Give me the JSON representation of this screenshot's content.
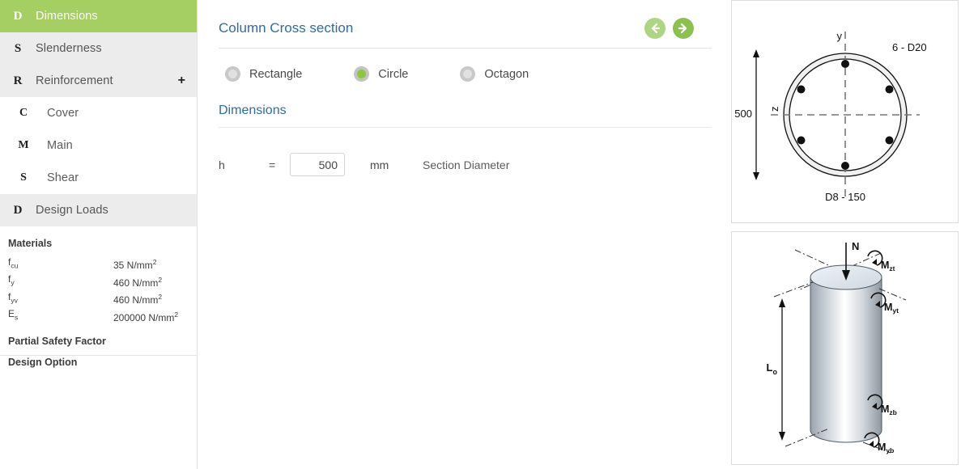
{
  "sidebar": {
    "items": [
      {
        "icon": "D",
        "label": "Dimensions",
        "state": "active",
        "sub": false,
        "expander": ""
      },
      {
        "icon": "S",
        "label": "Slenderness",
        "state": "gray",
        "sub": false,
        "expander": ""
      },
      {
        "icon": "R",
        "label": "Reinforcement",
        "state": "gray",
        "sub": false,
        "expander": "+"
      },
      {
        "icon": "C",
        "label": "Cover",
        "state": "white",
        "sub": true,
        "expander": ""
      },
      {
        "icon": "M",
        "label": "Main",
        "state": "white",
        "sub": true,
        "expander": ""
      },
      {
        "icon": "S",
        "label": "Shear",
        "state": "white",
        "sub": true,
        "expander": ""
      },
      {
        "icon": "D",
        "label": "Design Loads",
        "state": "gray",
        "sub": false,
        "expander": ""
      }
    ],
    "materials": {
      "title": "Materials",
      "rows": [
        {
          "symbol": "f",
          "sub": "cu",
          "value": "35 N/mm",
          "sup": "2"
        },
        {
          "symbol": "f",
          "sub": "y",
          "value": "460 N/mm",
          "sup": "2"
        },
        {
          "symbol": "f",
          "sub": "yv",
          "value": "460 N/mm",
          "sup": "2"
        },
        {
          "symbol": "E",
          "sub": "s",
          "value": "200000 N/mm",
          "sup": "2"
        }
      ]
    },
    "partial_safety_factor": "Partial Safety Factor",
    "design_option": "Design Option"
  },
  "main": {
    "title": "Column Cross section",
    "nav": {
      "back_icon": "arrow-left",
      "forward_icon": "arrow-right"
    },
    "shape_options": [
      {
        "label": "Rectangle",
        "selected": false
      },
      {
        "label": "Circle",
        "selected": true
      },
      {
        "label": "Octagon",
        "selected": false
      }
    ],
    "dimensions_heading": "Dimensions",
    "field": {
      "symbol": "h",
      "equals": "=",
      "value": "500",
      "unit": "mm",
      "description": "Section Diameter"
    }
  },
  "diagrams": {
    "cross_section": {
      "diameter_label": "500",
      "axis_y": "y",
      "axis_z": "z",
      "main_bars_label": "6 - D20",
      "links_label": "D8 - 150",
      "bar_count": 6
    },
    "column_3d": {
      "axial_load": "N",
      "height_label": "L",
      "height_sub": "o",
      "moment_top_z": "M",
      "moment_top_z_sub": "zt",
      "moment_top_y": "M",
      "moment_top_y_sub": "yt",
      "moment_bot_z": "M",
      "moment_bot_z_sub": "zb",
      "moment_bot_y": "M",
      "moment_bot_y_sub": "yb"
    }
  },
  "colors": {
    "active_green": "#a5ce63",
    "accent_green": "#8dc63f",
    "heading_blue": "#2e6da4",
    "row_gray": "#ececec"
  }
}
